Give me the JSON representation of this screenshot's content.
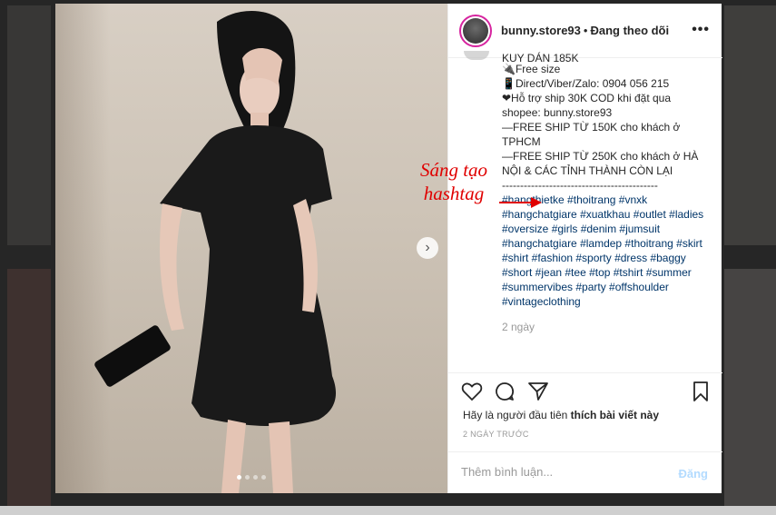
{
  "post": {
    "username": "bunny.store93",
    "separator": "•",
    "follow_status": "Đang theo dõi",
    "more_glyph": "•••",
    "caption_cut": "KUY DÁN 185K",
    "caption_lines": [
      "🔌Free size",
      "📱Direct/Viber/Zalo: 0904 056 215",
      "❤Hỗ trợ ship 30K COD khi đặt qua shopee: bunny.store93",
      "—FREE SHIP TỪ 150K cho khách ở TPHCM",
      "—FREE SHIP TỪ 250K cho khách ở HÀ NỘI & CÁC TỈNH THÀNH CÒN LẠI",
      "-------------------------------------------"
    ],
    "hashtags": "#hangthietke #thoitrang #vnxk #hangchatgiare #xuatkhau #outlet #ladies #oversize #girls #denim #jumsuit #hangchatgiare #lamdep #thoitrang #skirt #shirt #fashion #sporty #dress #baggy #short #jean #tee #top #tshirt #summer #summervibes #party #offshoulder #vintageclothing",
    "posted_ago": "2 ngày",
    "likes_prefix": "Hãy là người đầu tiên",
    "likes_action": "thích bài viết này",
    "timestamp": "2 NGÀY TRƯỚC",
    "comment_placeholder": "Thêm bình luận...",
    "post_button": "Đăng"
  },
  "annotation": {
    "line1": "Sáng tạo",
    "line2": "hashtag",
    "color": "#e00000"
  },
  "carousel": {
    "total_images": 4,
    "current_index": 1,
    "next_glyph": "›"
  },
  "icons": {
    "like": "heart-icon",
    "comment": "comment-icon",
    "share": "share-icon",
    "save": "bookmark-icon"
  },
  "colors": {
    "hashtag": "#003569",
    "text": "#262626",
    "muted": "#999999",
    "post_button": "#b3dbff",
    "avatar_ring": "#d6249f"
  }
}
